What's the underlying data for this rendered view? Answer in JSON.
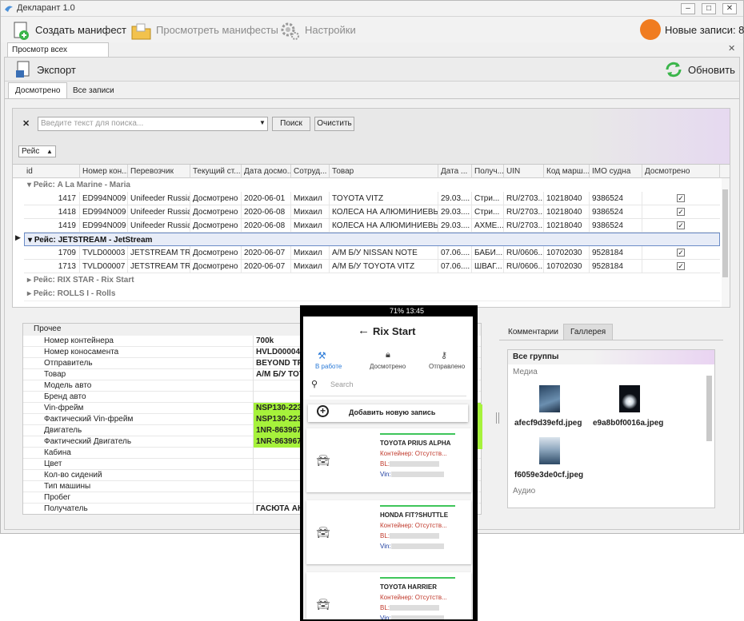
{
  "app": {
    "title": "Декларант 1.0"
  },
  "toolbar": {
    "create": "Создать манифест",
    "view": "Просмотреть манифесты",
    "settings": "Настройки",
    "new_records": "Новые записи: 8"
  },
  "doc_tab": "Просмотр всех манифестов",
  "export_btn": "Экспорт",
  "refresh_btn": "Обновить",
  "subtabs": [
    "Досмотрено",
    "Все записи"
  ],
  "search": {
    "placeholder": "Введите текст для поиска...",
    "search_btn": "Поиск",
    "clear_btn": "Очистить"
  },
  "group_by": "Рейс",
  "columns": [
    "id",
    "Номер кон...",
    "Перевозчик",
    "Текущий ст...",
    "Дата досмо...",
    "Сотруд...",
    "Товар",
    "Дата ...",
    "Получ...",
    "UIN",
    "Код марш...",
    "IMO судна",
    "Досмотрено"
  ],
  "groups": [
    {
      "title": "Рейс: A La Marine - Maria",
      "rows": [
        [
          "1417",
          "ED994N009",
          "Unifeeder Russia",
          "Досмотрено",
          "2020-06-01",
          "Михаил",
          "TOYOTA VITZ",
          "29.03....",
          "Стри...",
          "RU/2703...",
          "10218040",
          "9386524",
          "✓"
        ],
        [
          "1418",
          "ED994N009",
          "Unifeeder Russia",
          "Досмотрено",
          "2020-06-08",
          "Михаил",
          "КОЛЕСА НА АЛЮМИНИЕВЫХ ...",
          "29.03....",
          "Стри...",
          "RU/2703...",
          "10218040",
          "9386524",
          "✓"
        ],
        [
          "1419",
          "ED994N009",
          "Unifeeder Russia",
          "Досмотрено",
          "2020-06-08",
          "Михаил",
          "КОЛЕСА НА АЛЮМИНИЕВЫХ ...",
          "29.03....",
          "АХМЕ...",
          "RU/2703...",
          "10218040",
          "9386524",
          "✓"
        ]
      ]
    },
    {
      "title": "Рейс: JETSTREAM - JetStream",
      "rows": [
        [
          "1709",
          "TVLD00003",
          "JETSTREAM TR...",
          "Досмотрено",
          "2020-06-07",
          "Михаил",
          "А/М Б/У NISSAN NOTE",
          "07.06....",
          "БАБИ...",
          "RU/0606...",
          "10702030",
          "9528184",
          "✓"
        ],
        [
          "1713",
          "TVLD00007",
          "JETSTREAM TR...",
          "Досмотрено",
          "2020-06-07",
          "Михаил",
          "А/М Б/У TOYOTA VITZ",
          "07.06....",
          "ШВАГ...",
          "RU/0606...",
          "10702030",
          "9528184",
          "✓"
        ]
      ]
    },
    {
      "title": "Рейс: RIX STAR - Rix Start",
      "rows": []
    },
    {
      "title": "Рейс: ROLLS I - Rolls",
      "rows": []
    }
  ],
  "props": {
    "category": "Прочее",
    "rows": [
      [
        "Номер контейнера",
        "700k"
      ],
      [
        "Номер коносамента",
        "HVLD00004r"
      ],
      [
        "Отправитель",
        "BEYOND TRA"
      ],
      [
        "Товар",
        "А/М Б/У TOY"
      ],
      [
        "Модель авто",
        ""
      ],
      [
        "Бренд авто",
        ""
      ],
      [
        "Vin-фрейм",
        "NSP130-223"
      ],
      [
        "Фактический Vin-фрейм",
        "NSP130-223"
      ],
      [
        "Двигатель",
        "1NR-863967"
      ],
      [
        "Фактический Двигатель",
        "1NR-863967"
      ],
      [
        "Кабина",
        ""
      ],
      [
        "Цвет",
        ""
      ],
      [
        "Кол-во сидений",
        ""
      ],
      [
        "Тип машины",
        ""
      ],
      [
        "Пробег",
        ""
      ],
      [
        "Получатель",
        "ГАСЮТА АН"
      ]
    ]
  },
  "right_panel": {
    "tabs": [
      "Комментарии",
      "Галлерея"
    ],
    "group_all": "Все группы",
    "media": "Медиа",
    "audio": "Аудио",
    "files": [
      "afecf9d39efd.jpeg",
      "e9a8b0f0016a.jpeg",
      "f6059e3de0cf.jpeg"
    ]
  },
  "phone": {
    "status": "71% 13:45",
    "title": "Rix Start",
    "back": "←",
    "tabs": [
      "В работе",
      "Досмотрено",
      "Отправлено"
    ],
    "search": "Search",
    "add": "Добавить новую запись",
    "cards": [
      {
        "name": "TOYOTA PRIUS ALPHA",
        "container": "Контейнер: Отсутств...",
        "bl": "BL:",
        "vin": "Vin:"
      },
      {
        "name": "HONDA FIT?SHUTTLE",
        "container": "Контейнер: Отсутств...",
        "bl": "BL:",
        "vin": "Vin:"
      },
      {
        "name": "TOYOTA HARRIER",
        "container": "Контейнер: Отсутств...",
        "bl": "BL:",
        "vin": "Vin:"
      }
    ]
  },
  "colors": {
    "accent_orange": "#f07c20",
    "green_highlight": "#a6f23b",
    "phone_accent": "#2a7ad8",
    "card_green": "#3fc55a"
  }
}
